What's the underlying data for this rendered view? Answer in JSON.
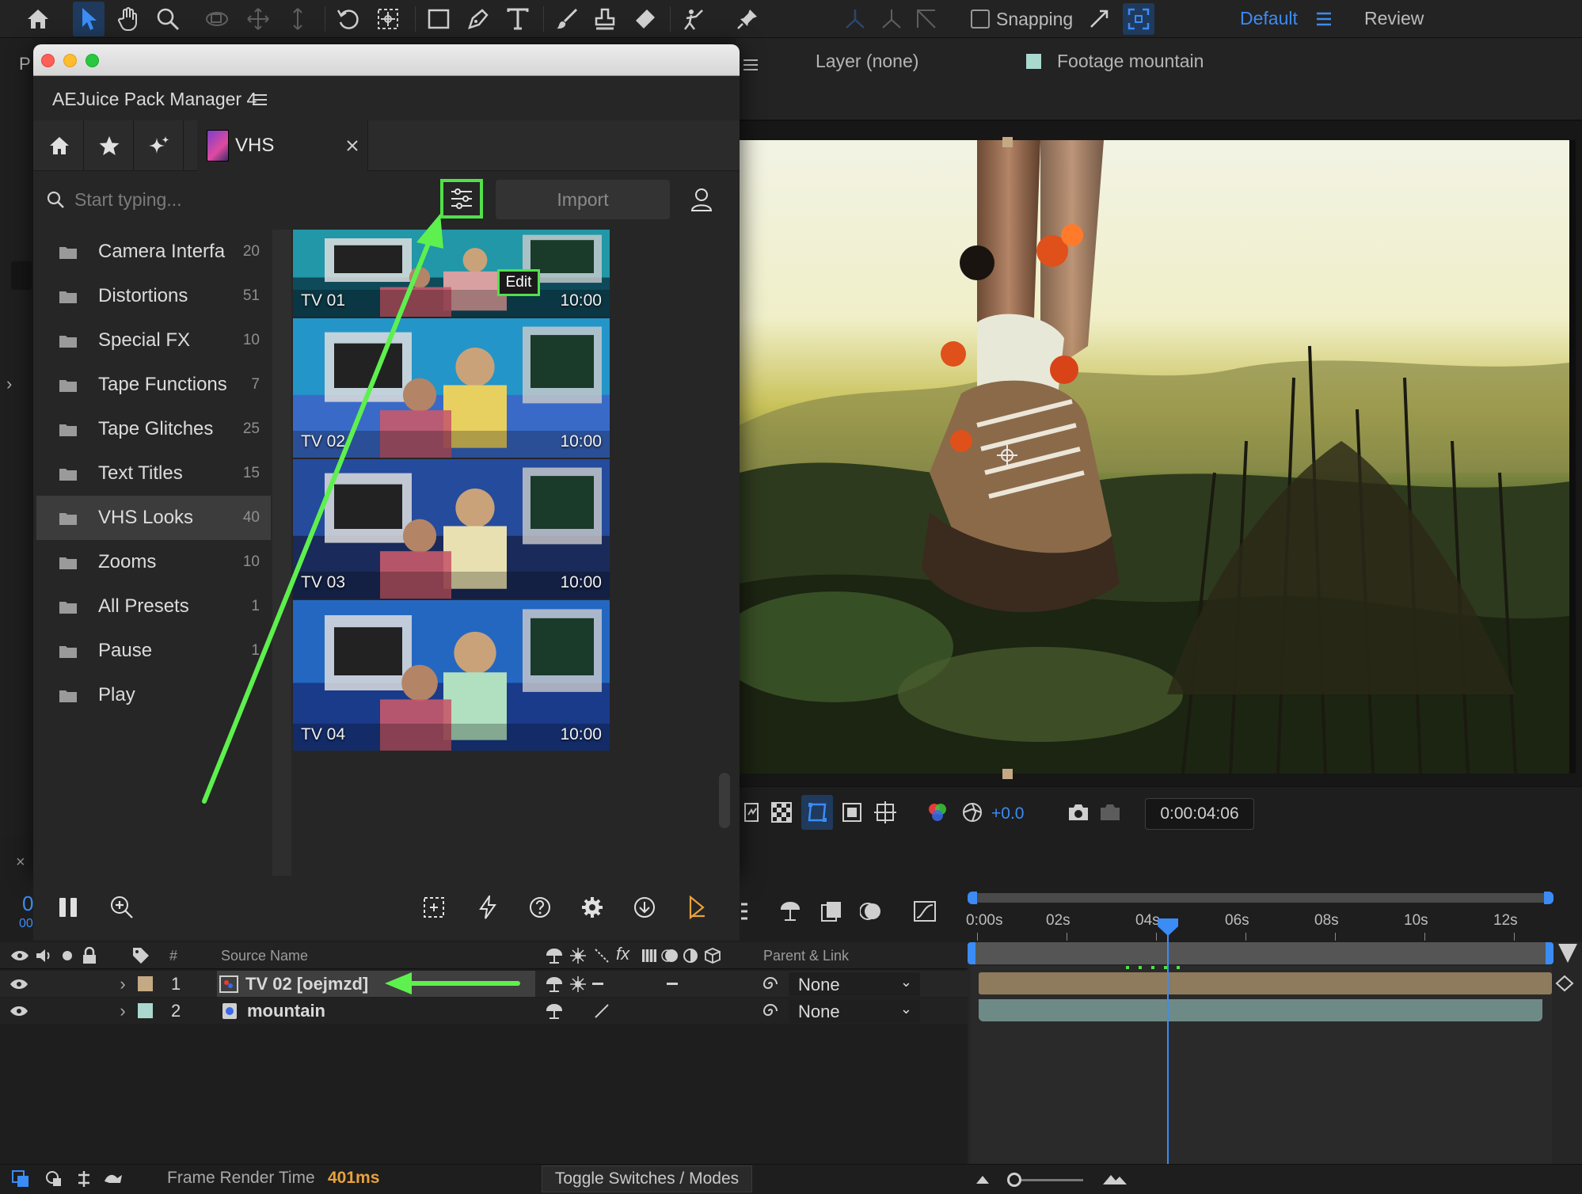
{
  "toolbar": {
    "snapping_label": "Snapping",
    "workspace_default": "Default",
    "workspace_review": "Review"
  },
  "viewer": {
    "layer_label": "Layer (none)",
    "footage_label": "Footage mountain",
    "exposure": "+0.0",
    "timecode": "0:00:04:06"
  },
  "panel": {
    "title": "AEJuice Pack Manager 4",
    "tab_label": "VHS",
    "search_placeholder": "Start typing...",
    "import_label": "Import",
    "edit_tooltip": "Edit",
    "categories": [
      {
        "name": "Camera Interfa",
        "count": "20"
      },
      {
        "name": "Distortions",
        "count": "51"
      },
      {
        "name": "Special FX",
        "count": "10"
      },
      {
        "name": "Tape Functions",
        "count": "7"
      },
      {
        "name": "Tape Glitches",
        "count": "25"
      },
      {
        "name": "Text Titles",
        "count": "15"
      },
      {
        "name": "VHS Looks",
        "count": "40"
      },
      {
        "name": "Zooms",
        "count": "10"
      },
      {
        "name": "All Presets",
        "count": "1"
      },
      {
        "name": "Pause",
        "count": "1"
      },
      {
        "name": "Play",
        "count": ""
      }
    ],
    "active_category": "VHS Looks",
    "presets": [
      {
        "name": "TV 01",
        "duration": "10:00"
      },
      {
        "name": "TV 02",
        "duration": "10:00"
      },
      {
        "name": "TV 03",
        "duration": "10:00"
      },
      {
        "name": "TV 04",
        "duration": "10:00"
      }
    ]
  },
  "timeline": {
    "columns": {
      "number": "#",
      "source_name": "Source Name",
      "parent_link": "Parent & Link"
    },
    "ruler_labels": [
      "0:00s",
      "02s",
      "04s",
      "06s",
      "08s",
      "10s",
      "12s"
    ],
    "layers": [
      {
        "index": "1",
        "name": "TV 02 [oejmzd]",
        "parent": "None",
        "color": "#c4a984"
      },
      {
        "index": "2",
        "name": "mountain",
        "parent": "None",
        "color": "#a9d8cf"
      }
    ],
    "playhead_seconds": 4.25
  },
  "status": {
    "frame_render_label": "Frame Render Time",
    "frame_render_value": "401ms",
    "toggle_label": "Toggle Switches / Modes"
  },
  "colors": {
    "accent_blue": "#3b8cf5",
    "highlight_green": "#52e04a",
    "render_orange": "#e8a23c"
  }
}
